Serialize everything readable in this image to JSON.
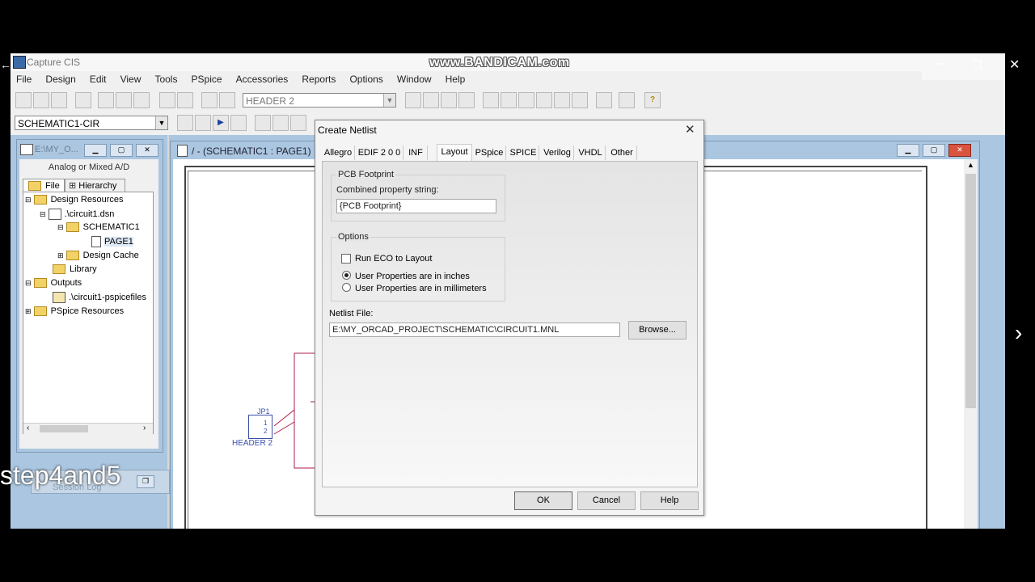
{
  "app": {
    "title": "Capture CIS",
    "watermark": "www.BANDICAM.com"
  },
  "menu": [
    "File",
    "Design",
    "Edit",
    "View",
    "Tools",
    "PSpice",
    "Accessories",
    "Reports",
    "Options",
    "Window",
    "Help"
  ],
  "toolbar": {
    "part_combo": "HEADER 2",
    "schematic_combo": "SCHEMATIC1-CIR"
  },
  "project": {
    "title": "E:\\MY_O...",
    "mode": "Analog or Mixed A/D",
    "tabs": [
      "File",
      "Hierarchy"
    ],
    "tree": [
      "Design Resources",
      ".\\circuit1.dsn",
      "SCHEMATIC1",
      "PAGE1",
      "Design Cache",
      "Library",
      "Outputs",
      ".\\circuit1-pspicefiles",
      "PSpice Resources"
    ]
  },
  "schematic": {
    "title": "/ - (SCHEMATIC1 : PAGE1)",
    "part_ref": "JP1",
    "part_name": "HEADER 2",
    "pin1": "1",
    "pin2": "2"
  },
  "session_log": "Session Log",
  "overlay_caption": "step4and5",
  "dialog": {
    "title": "Create Netlist",
    "tabs": [
      "Allegro",
      "EDIF 2 0 0",
      "INF",
      "Layout",
      "PSpice",
      "SPICE",
      "Verilog",
      "VHDL",
      "Other"
    ],
    "active_tab": "Layout",
    "pcb_group": "PCB Footprint",
    "combined_label": "Combined property string:",
    "combined_value": "{PCB Footprint}",
    "options_group": "Options",
    "run_eco": "Run ECO to Layout",
    "inches": "User Properties are in inches",
    "millimeters": "User Properties are in millimeters",
    "netlist_label": "Netlist File:",
    "netlist_value": "E:\\MY_ORCAD_PROJECT\\SCHEMATIC\\CIRCUIT1.MNL",
    "browse": "Browse...",
    "ok": "OK",
    "cancel": "Cancel",
    "help": "Help"
  }
}
